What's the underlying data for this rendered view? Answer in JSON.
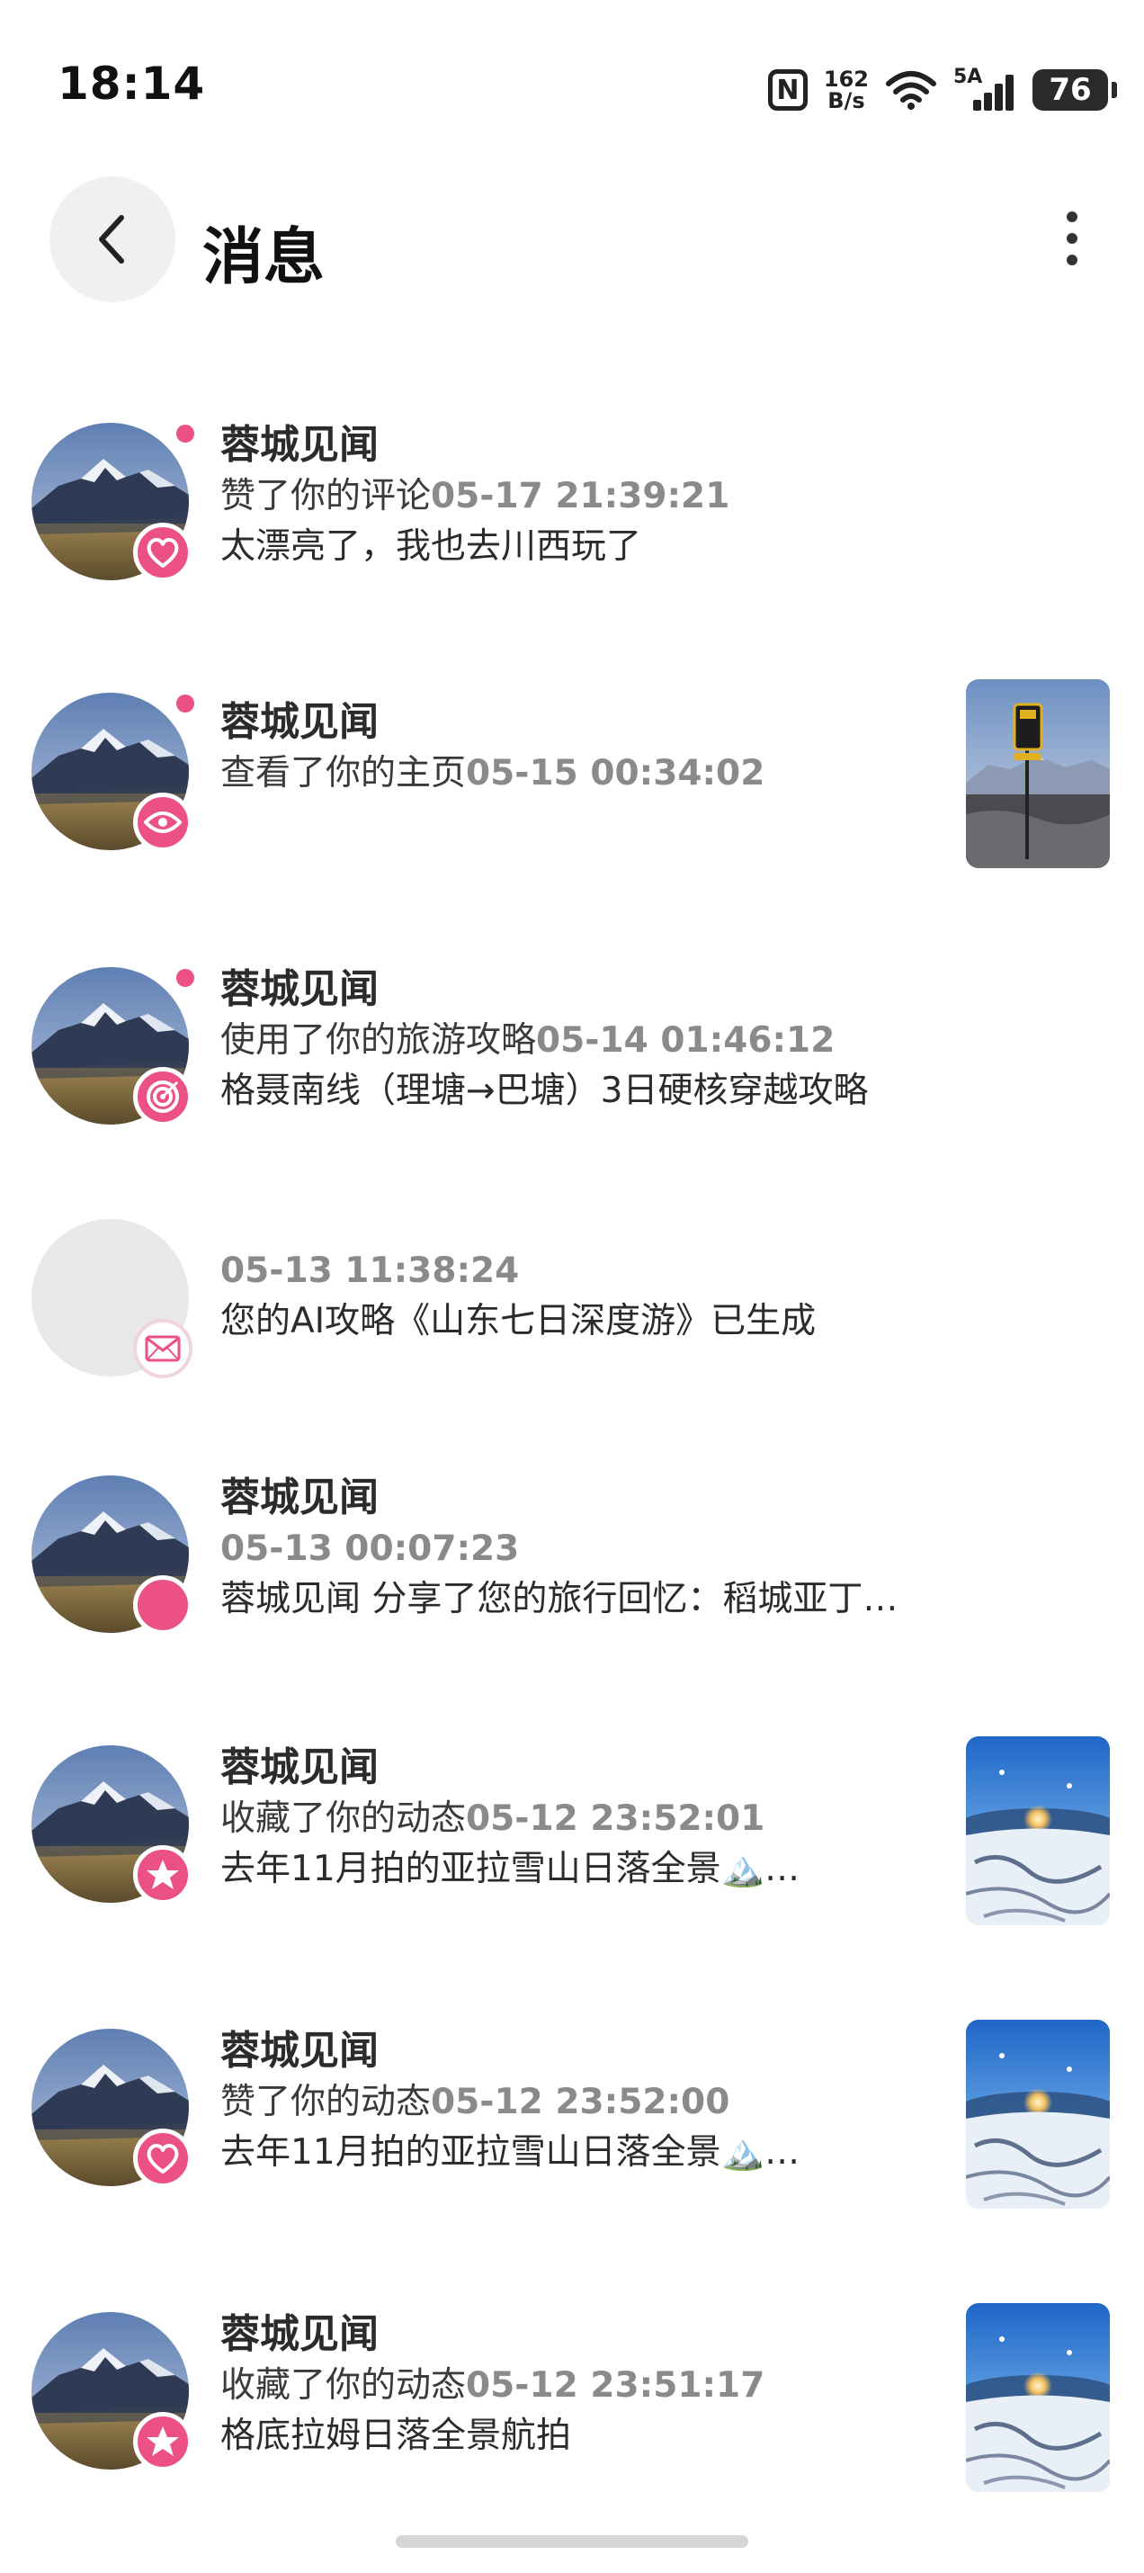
{
  "status_bar": {
    "time": "18:14",
    "nfc": "N",
    "net_speed_value": "162",
    "net_speed_unit": "B/s",
    "signal_label": "5A",
    "battery": "76"
  },
  "header": {
    "title": "消息"
  },
  "messages": [
    {
      "name": "蓉城见闻",
      "action": "赞了你的评论",
      "time": "05-17 21:39:21",
      "content": "太漂亮了，我也去川西玩了",
      "badge": "heart-icon",
      "unread": true,
      "thumbnail": false
    },
    {
      "name": "蓉城见闻",
      "action": "查看了你的主页",
      "time": "05-15 00:34:02",
      "content": "",
      "badge": "eye-icon",
      "unread": true,
      "thumbnail": true
    },
    {
      "name": "蓉城见闻",
      "action": "使用了你的旅游攻略",
      "time": "05-14 01:46:12",
      "content": "格聂南线（理塘→巴塘）3日硬核穿越攻略",
      "badge": "target-icon",
      "unread": true,
      "thumbnail": false
    },
    {
      "name": "",
      "action": "",
      "time": "05-13 11:38:24",
      "content": "您的AI攻略《山东七日深度游》已生成",
      "badge": "mail-icon",
      "unread": false,
      "thumbnail": false
    },
    {
      "name": "蓉城见闻",
      "action": "",
      "time": "05-13 00:07:23",
      "content": "蓉城见闻 分享了您的旅行回忆：稻城亚丁：雪域…",
      "badge": "share-icon",
      "unread": false,
      "thumbnail": false
    },
    {
      "name": "蓉城见闻",
      "action": "收藏了你的动态",
      "time": "05-12 23:52:01",
      "content": "去年11月拍的亚拉雪山日落全景🏔️…",
      "badge": "star-icon",
      "unread": false,
      "thumbnail": true
    },
    {
      "name": "蓉城见闻",
      "action": "赞了你的动态",
      "time": "05-12 23:52:00",
      "content": "去年11月拍的亚拉雪山日落全景🏔️…",
      "badge": "heart-icon",
      "unread": false,
      "thumbnail": true
    },
    {
      "name": "蓉城见闻",
      "action": "收藏了你的动态",
      "time": "05-12 23:51:17",
      "content": "格底拉姆日落全景航拍",
      "badge": "star-icon",
      "unread": false,
      "thumbnail": true
    }
  ],
  "colors": {
    "accent": "#ec5186",
    "timestamp": "#8a8a8a",
    "dot": "#ec5186"
  }
}
